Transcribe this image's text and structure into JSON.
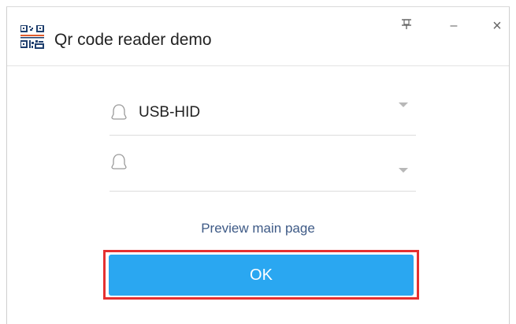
{
  "window": {
    "title": "Qr code reader demo",
    "icons": {
      "app": "qr-code-icon",
      "pin": "pin-icon",
      "minimize": "minimize-icon",
      "close": "close-icon"
    },
    "minimize_glyph": "–",
    "close_glyph": "×"
  },
  "form": {
    "device_select": {
      "value": "USB-HID",
      "icon": "device-icon"
    },
    "second_select": {
      "value": "",
      "icon": "device-icon"
    },
    "preview_link": "Preview main page",
    "ok_label": "OK"
  },
  "colors": {
    "accent": "#2aa7f1",
    "link": "#3e5a86",
    "highlight_outline": "#e53030"
  }
}
